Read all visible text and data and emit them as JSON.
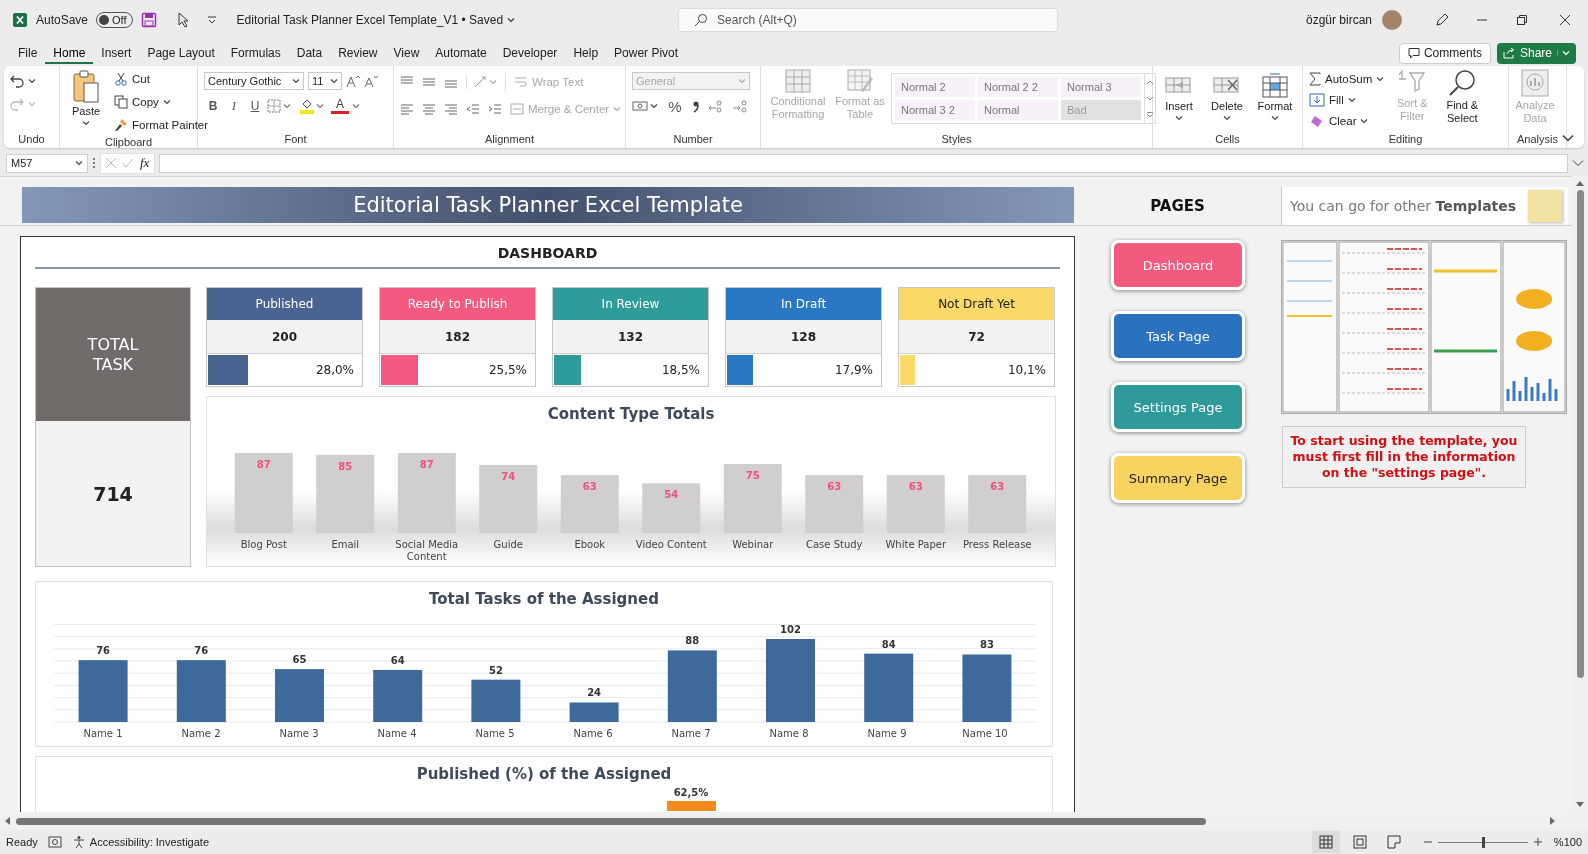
{
  "title_bar": {
    "autosave_label": "AutoSave",
    "autosave": {
      "on": false,
      "label": "Off"
    },
    "document_title": "Editorial Task Planner Excel Template_V1 • Saved",
    "search": {
      "placeholder": "Search (Alt+Q)"
    },
    "user_name": "özgür bircan"
  },
  "ribbon_tabs": [
    {
      "label": "File",
      "selected": false
    },
    {
      "label": "Home",
      "selected": true
    },
    {
      "label": "Insert",
      "selected": false
    },
    {
      "label": "Page Layout",
      "selected": false
    },
    {
      "label": "Formulas",
      "selected": false
    },
    {
      "label": "Data",
      "selected": false
    },
    {
      "label": "Review",
      "selected": false
    },
    {
      "label": "View",
      "selected": false
    },
    {
      "label": "Automate",
      "selected": false
    },
    {
      "label": "Developer",
      "selected": false
    },
    {
      "label": "Help",
      "selected": false
    },
    {
      "label": "Power Pivot",
      "selected": false
    }
  ],
  "comments_button": "Comments",
  "share_button": "Share",
  "ribbon": {
    "groups": [
      {
        "kind": "undo",
        "label": "Undo",
        "buttons": [
          {
            "disabled": false
          },
          {
            "disabled": true
          }
        ]
      },
      {
        "kind": "clipboard",
        "label": "Clipboard",
        "paste": "Paste",
        "commands": [
          "Cut",
          "Copy",
          "Format Painter"
        ]
      },
      {
        "kind": "font",
        "label": "Font",
        "font_name": "Century Gothic",
        "font_size": "11",
        "format_buttons": [
          "B",
          "I",
          "U"
        ],
        "font_color": "A"
      },
      {
        "kind": "alignment",
        "label": "Alignment",
        "commands": [
          {
            "label": "Wrap Text",
            "disabled": true
          },
          {
            "label": "Merge & Center",
            "disabled": true
          }
        ]
      },
      {
        "kind": "number",
        "label": "Number",
        "format": {
          "value": "General",
          "disabled": true
        },
        "percent": "%"
      },
      {
        "kind": "styles",
        "label": "Styles",
        "commands": [
          {
            "label": "Conditional Formatting",
            "disabled": true
          },
          {
            "label": "Format as Table",
            "disabled": true
          }
        ],
        "gallery": [
          "Normal 2",
          "Normal 2 2",
          "Normal 3",
          "Normal 3 2",
          "Normal",
          "Bad"
        ]
      },
      {
        "kind": "cells",
        "label": "Cells",
        "commands": [
          "Insert",
          "Delete",
          "Format"
        ]
      },
      {
        "kind": "editing",
        "label": "Editing",
        "commands": [
          {
            "label": "AutoSum",
            "disabled": false
          },
          {
            "label": "Fill",
            "disabled": false
          },
          {
            "label": "Clear",
            "disabled": false
          }
        ],
        "large": [
          {
            "label": "Sort & Filter",
            "disabled": true
          },
          {
            "label": "Find & Select",
            "disabled": false
          }
        ]
      },
      {
        "kind": "analysis",
        "label": "Analysis",
        "commands": [
          {
            "label": "Analyze Data",
            "disabled": true
          }
        ]
      }
    ]
  },
  "formula_bar": {
    "name_box": "M57",
    "fx": "fx"
  },
  "sheet": {
    "banner": "Editorial Task Planner Excel Template",
    "pages_heading": "PAGES",
    "templates_link": "You can go for other **Templates**",
    "dashboard": {
      "title": "DASHBOARD",
      "total": {
        "label": "TOTAL TASK",
        "value": "714"
      },
      "statuses": [
        {
          "label": "Published",
          "count": "200",
          "percent": "28,0%",
          "level": 0.28,
          "color": "#4a6491"
        },
        {
          "label": "Ready to Publish",
          "count": "182",
          "percent": "25,5%",
          "level": 0.255,
          "color": "#f45a80"
        },
        {
          "label": "In Review",
          "count": "132",
          "percent": "18,5%",
          "level": 0.185,
          "color": "#2e9c9a"
        },
        {
          "label": "In Draft",
          "count": "128",
          "percent": "17,9%",
          "level": 0.179,
          "color": "#2a78c4"
        },
        {
          "label": "Not Draft Yet",
          "count": "72",
          "percent": "10,1%",
          "level": 0.101,
          "color": "#fbd968"
        }
      ],
      "content_chart": {
        "chart_data": {
          "type": "bar",
          "title": "Content Type Totals",
          "categories": [
            "Blog Post",
            "Email",
            "Social Media Content",
            "Guide",
            "Ebook",
            "Video Content",
            "Webinar",
            "Case Study",
            "White Paper",
            "Press Release"
          ],
          "values": [
            87,
            85,
            87,
            74,
            63,
            54,
            75,
            63,
            63,
            63
          ],
          "data_labels": true
        }
      },
      "assigned_chart": {
        "chart_data": {
          "type": "bar",
          "title": "Total Tasks of the Assigned",
          "categories": [
            "Name 1",
            "Name 2",
            "Name 3",
            "Name 4",
            "Name 5",
            "Name 6",
            "Name 7",
            "Name 8",
            "Name 9",
            "Name 10"
          ],
          "values": [
            76,
            76,
            65,
            64,
            52,
            24,
            88,
            102,
            84,
            83
          ],
          "data_labels": true
        }
      },
      "published_chart": {
        "title": "Published (%) of the Assigned",
        "value_label": "62,5%"
      }
    },
    "pages": [
      {
        "label": "Dashboard",
        "color": "#f25a7e"
      },
      {
        "label": "Task Page",
        "color": "#2a72bd"
      },
      {
        "label": "Settings Page",
        "color": "#2e9a99"
      },
      {
        "label": "Summary Page",
        "color": "#f7d462"
      }
    ],
    "note": "To start using the template, you must first fill in the information on the \"settings page\"."
  },
  "status_bar": {
    "mode": "Ready",
    "accessibility": "Accessibility: Investigate",
    "views": [
      {
        "selected": true
      },
      {
        "selected": false
      },
      {
        "selected": false
      }
    ],
    "zoom": {
      "level": 0.5,
      "label": "%100"
    }
  }
}
